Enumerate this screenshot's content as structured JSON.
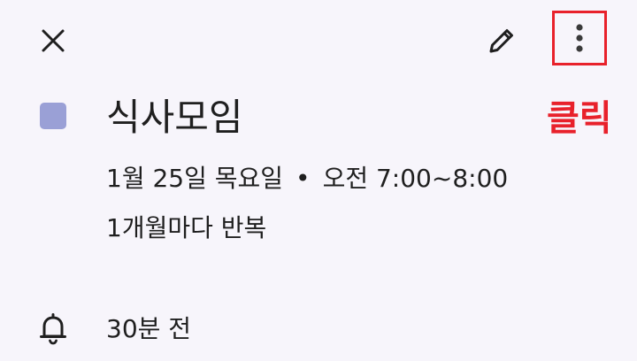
{
  "toolbar": {
    "close_icon": "close-icon",
    "edit_icon": "pencil-icon",
    "more_icon": "more-vert-icon"
  },
  "event": {
    "color": "#9aa0d6",
    "title": "식사모임",
    "date": "1월 25일 목요일",
    "separator": "•",
    "time": "오전 7:00~8:00",
    "repeat": "1개월마다 반복"
  },
  "reminder": {
    "icon": "bell-icon",
    "text": "30분 전"
  },
  "annotation": {
    "label": "클릭",
    "color": "#e8212b"
  }
}
